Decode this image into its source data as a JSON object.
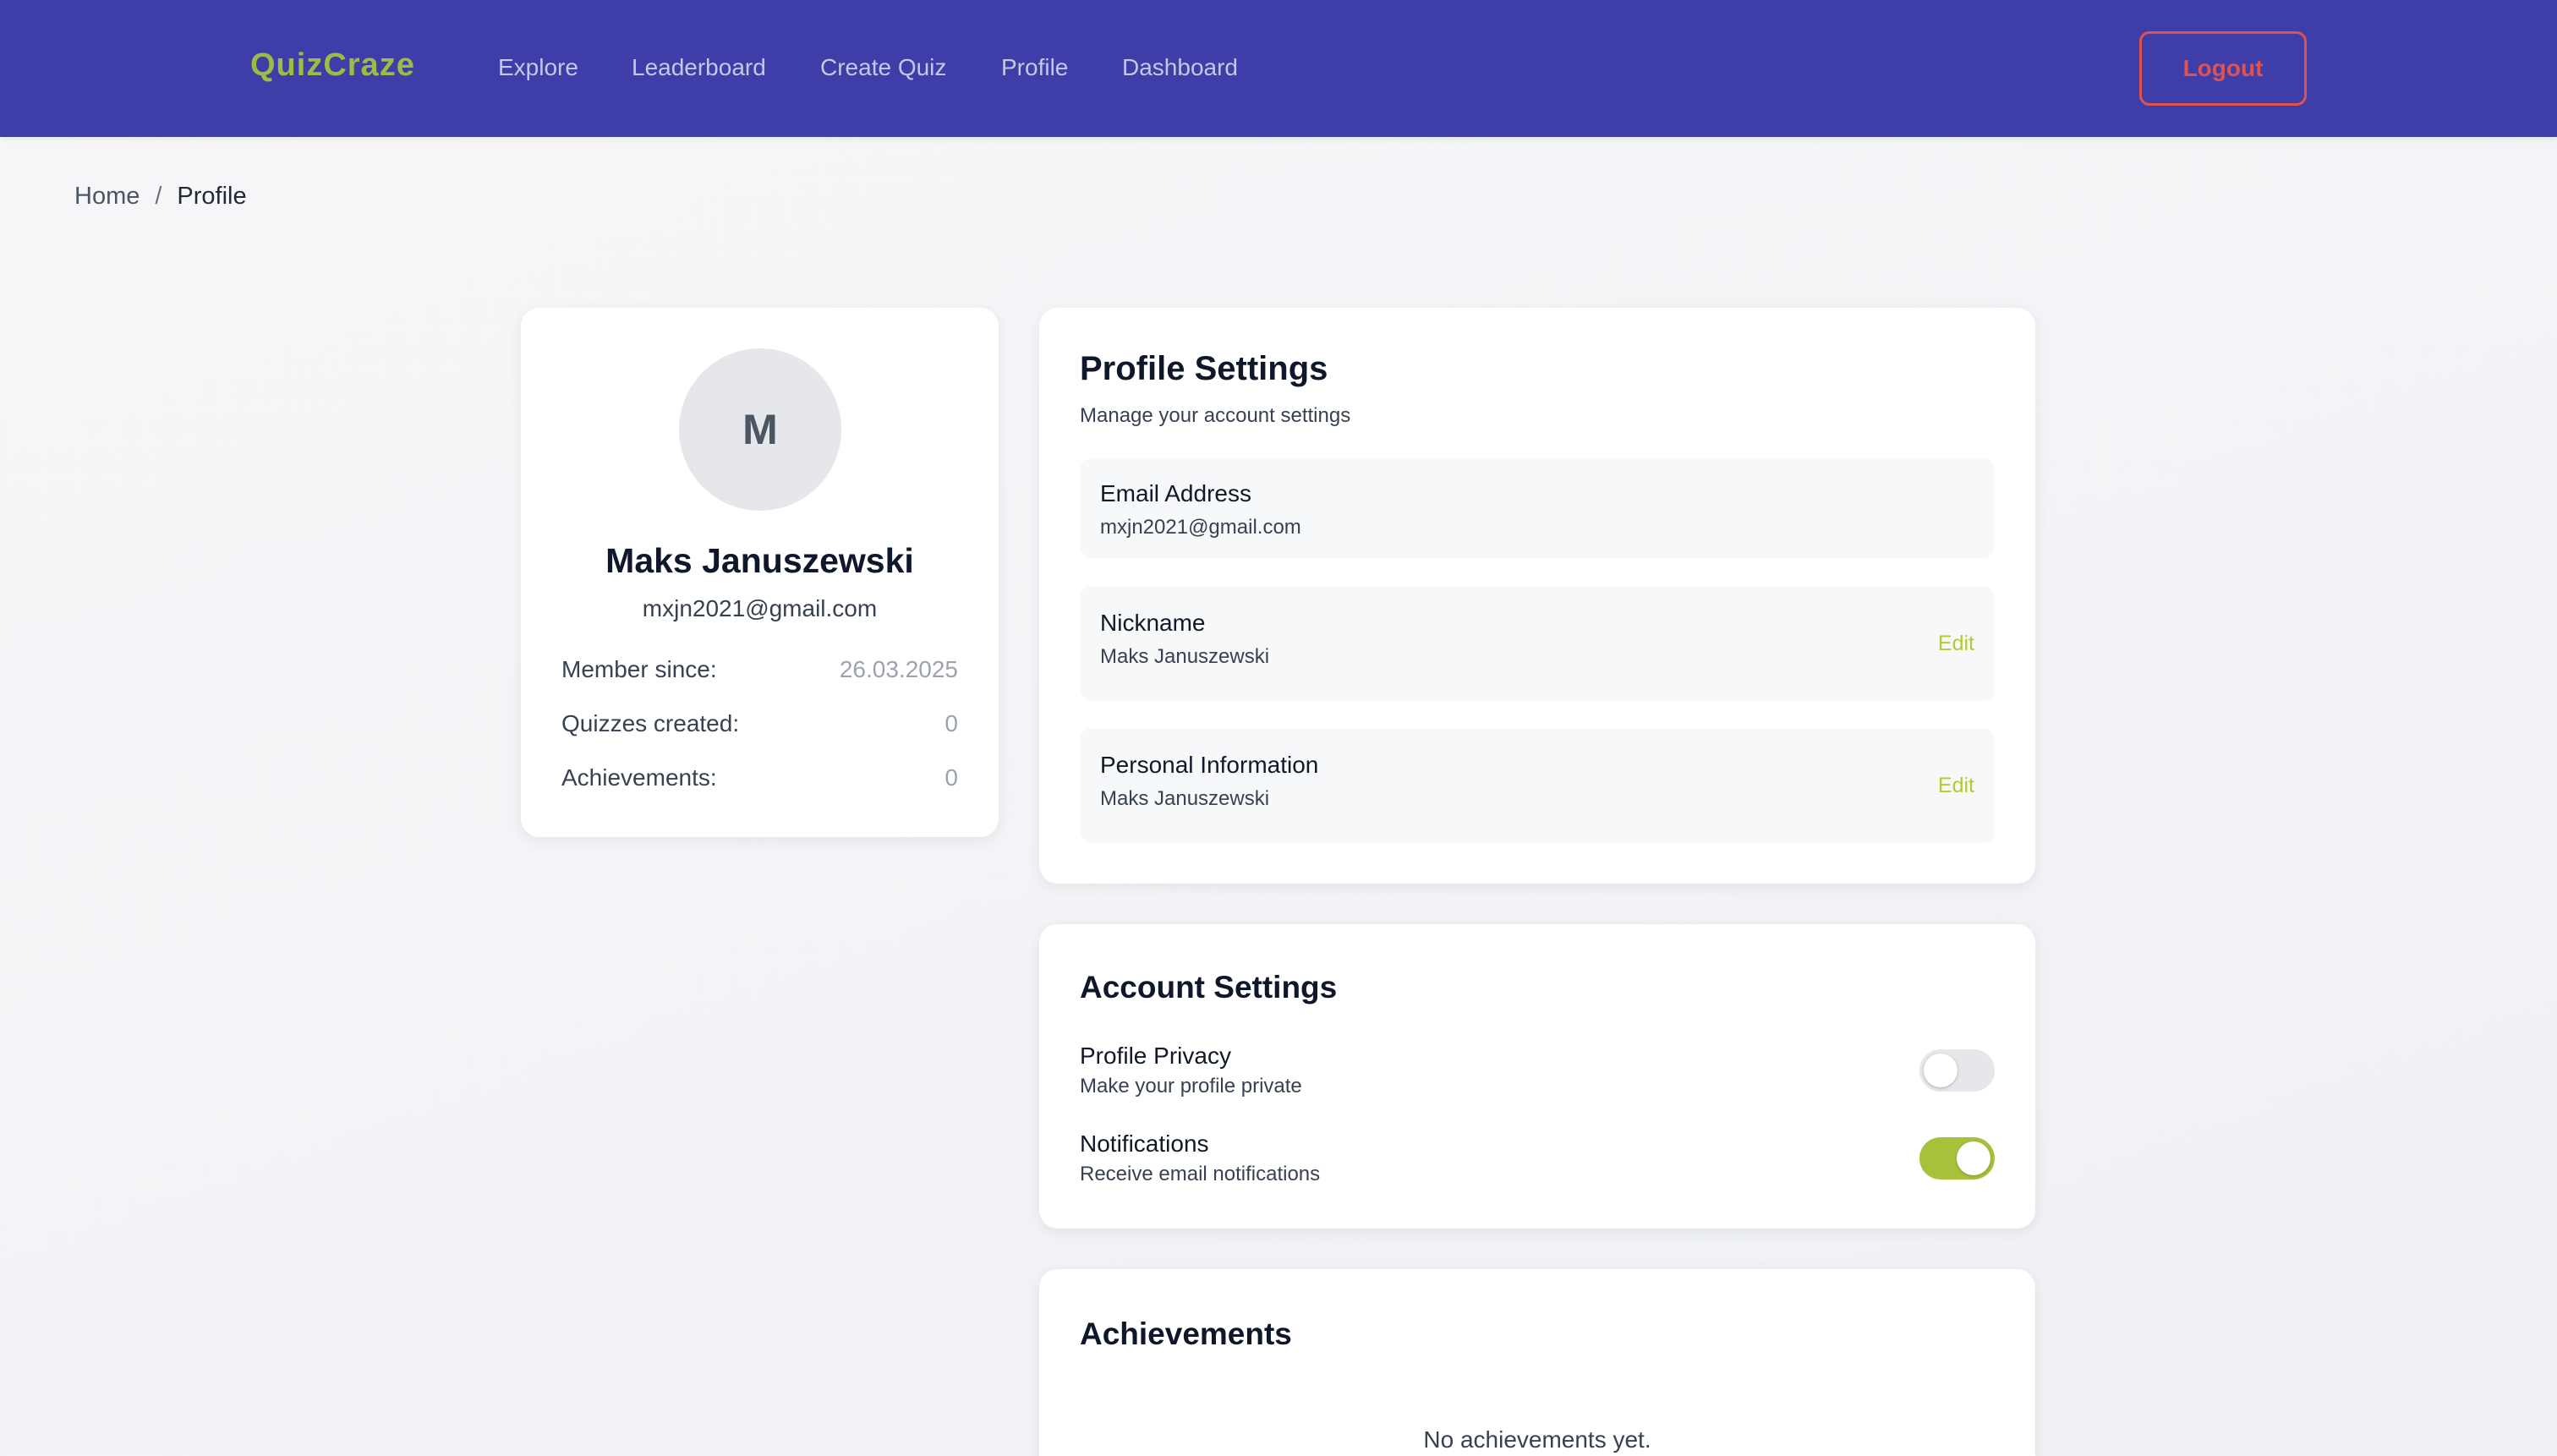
{
  "nav": {
    "brand": "QuizCraze",
    "links": [
      "Explore",
      "Leaderboard",
      "Create Quiz",
      "Profile",
      "Dashboard"
    ],
    "logout_label": "Logout"
  },
  "breadcrumb": {
    "home": "Home",
    "separator": "/",
    "current": "Profile"
  },
  "profile_card": {
    "avatar_initial": "M",
    "name": "Maks Januszewski",
    "email": "mxjn2021@gmail.com",
    "stats": [
      {
        "label": "Member since:",
        "value": "26.03.2025"
      },
      {
        "label": "Quizzes created:",
        "value": "0"
      },
      {
        "label": "Achievements:",
        "value": "0"
      }
    ]
  },
  "profile_settings": {
    "title": "Profile Settings",
    "subtitle": "Manage your account settings",
    "fields": [
      {
        "label": "Email Address",
        "value": "mxjn2021@gmail.com"
      },
      {
        "label": "Nickname",
        "value": "Maks Januszewski",
        "action": "Edit"
      },
      {
        "label": "Personal Information",
        "value": "Maks Januszewski",
        "action": "Edit"
      }
    ]
  },
  "account_settings": {
    "title": "Account Settings",
    "toggles": [
      {
        "label": "Profile Privacy",
        "description": "Make your profile private",
        "enabled": false
      },
      {
        "label": "Notifications",
        "description": "Receive email notifications",
        "enabled": true
      }
    ]
  },
  "achievements": {
    "title": "Achievements",
    "empty_text": "No achievements yet."
  },
  "colors": {
    "nav_bg": "#3f3da8",
    "brand": "#9bbd45",
    "logout": "#e0524f",
    "edit_link": "#b3c93a",
    "toggle_on": "#a6c23b",
    "toggle_off": "#e5e7eb"
  }
}
